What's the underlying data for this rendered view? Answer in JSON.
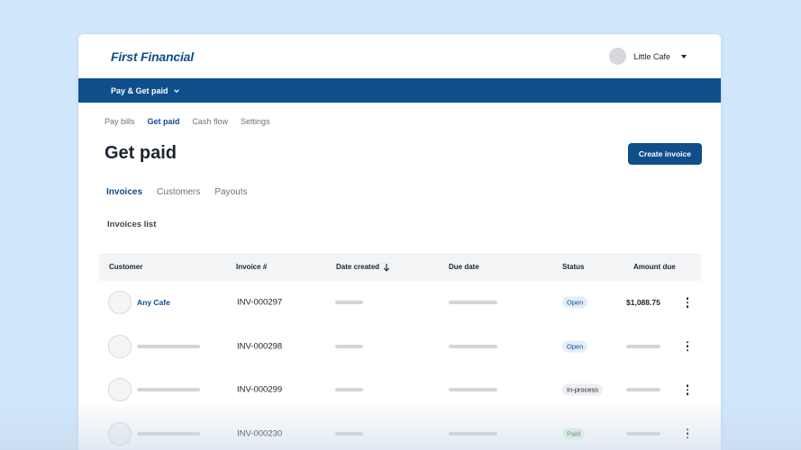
{
  "brand": {
    "logo_text": "First Financial",
    "color": "#0f4e8a"
  },
  "user": {
    "name": "Little Cafe"
  },
  "navbar": {
    "menu_label": "Pay & Get paid"
  },
  "subnav": {
    "items": [
      "Pay bills",
      "Get paid",
      "Cash flow",
      "Settings"
    ],
    "active": "Get paid"
  },
  "page": {
    "title": "Get paid",
    "create_button": "Create invoice"
  },
  "tabs": {
    "items": [
      "Invoices",
      "Customers",
      "Payouts"
    ],
    "active": "Invoices"
  },
  "list": {
    "title": "Invoices list"
  },
  "table": {
    "columns": [
      "Customer",
      "Invoice #",
      "Date created",
      "Due date",
      "Status",
      "Amount due"
    ],
    "sort_column": "Date created",
    "rows": [
      {
        "customer": "Any Cafe",
        "invoice": "INV-000297",
        "status": "Open",
        "amount": "$1,088.75"
      },
      {
        "customer": "",
        "invoice": "INV-000298",
        "status": "Open",
        "amount": ""
      },
      {
        "customer": "",
        "invoice": "INV-000299",
        "status": "In-process",
        "amount": ""
      },
      {
        "customer": "",
        "invoice": "INV-000230",
        "status": "Paid",
        "amount": ""
      }
    ]
  },
  "icons": {
    "menu_chevron": "chevron-down-icon",
    "sort": "arrow-down-icon",
    "row_menu": "kebab-menu-icon",
    "user_caret": "caret-down-icon"
  }
}
